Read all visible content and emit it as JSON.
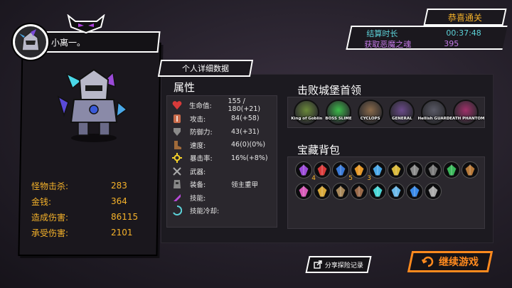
{
  "player": {
    "name": "小离一。"
  },
  "left_stats": [
    {
      "label": "怪物击杀:",
      "value": "283"
    },
    {
      "label": "金钱:",
      "value": "364"
    },
    {
      "label": "造成伤害:",
      "value": "86115"
    },
    {
      "label": "承受伤害:",
      "value": "2101"
    }
  ],
  "tab_label": "个人详细数据",
  "attributes": {
    "title": "属性",
    "rows": [
      {
        "icon": "heart-icon",
        "label": "生命值:",
        "value": "155 / 180(+21)"
      },
      {
        "icon": "sword-icon",
        "label": "攻击:",
        "value": "84(+58)"
      },
      {
        "icon": "shield-icon",
        "label": "防御力:",
        "value": "43(+31)"
      },
      {
        "icon": "boot-icon",
        "label": "速度:",
        "value": "46(0)(0%)"
      },
      {
        "icon": "burst-icon",
        "label": "暴击率:",
        "value": "16%(+8%)"
      },
      {
        "icon": "weapon-icon",
        "label": "武器:",
        "value": ""
      },
      {
        "icon": "armor-icon",
        "label": "装备:",
        "value": "领主重甲"
      },
      {
        "icon": "skill-icon",
        "label": "技能:",
        "value": ""
      },
      {
        "icon": "cooldown-icon",
        "label": "技能冷却:",
        "value": ""
      }
    ]
  },
  "bosses": {
    "title": "击败城堡首领",
    "items": [
      {
        "tag": "King of Goblin",
        "color": "#6b8a3a"
      },
      {
        "tag": "BOSS SLIME",
        "color": "#3dbb4a"
      },
      {
        "tag": "CYCLOPS",
        "color": "#8a6a4a"
      },
      {
        "tag": "GENERAL",
        "color": "#6a4a8a"
      },
      {
        "tag": "Hellish GUARD",
        "color": "#5a5a66"
      },
      {
        "tag": "DEATH PHANTOM",
        "color": "#a0306a"
      }
    ]
  },
  "inventory": {
    "title": "宝藏背包",
    "items": [
      {
        "name": "purple-crystal-icon",
        "color": "#9b4ad8",
        "count": "4"
      },
      {
        "name": "red-gem-icon",
        "color": "#d83a3a",
        "count": ""
      },
      {
        "name": "blue-gem-icon",
        "color": "#3a7ad8",
        "count": "5"
      },
      {
        "name": "fire-orb-icon",
        "color": "#e89a2a",
        "count": "3"
      },
      {
        "name": "blue-shard-icon",
        "color": "#4aa8e8",
        "count": ""
      },
      {
        "name": "gold-ring-icon",
        "color": "#d8b83a",
        "count": ""
      },
      {
        "name": "gray-scroll-icon",
        "color": "#8a8a8a",
        "count": ""
      },
      {
        "name": "hooded-figure-icon",
        "color": "#7a7a7a",
        "count": ""
      },
      {
        "name": "green-flower-icon",
        "color": "#3ab85a",
        "count": ""
      },
      {
        "name": "brown-bag-icon",
        "color": "#b87a3a",
        "count": ""
      },
      {
        "name": "pink-swirl-icon",
        "color": "#d85ab8",
        "count": ""
      },
      {
        "name": "gold-coin-icon",
        "color": "#d8a83a",
        "count": ""
      },
      {
        "name": "treasure-map-icon",
        "color": "#a8885a",
        "count": ""
      },
      {
        "name": "brown-stone-icon",
        "color": "#9a6a4a",
        "count": ""
      },
      {
        "name": "cyan-flake-icon",
        "color": "#4ad8d8",
        "count": ""
      },
      {
        "name": "ice-crystal-icon",
        "color": "#6ab8e8",
        "count": ""
      },
      {
        "name": "blue-flame-icon",
        "color": "#3a8ae8",
        "count": ""
      },
      {
        "name": "knight-helmet-icon",
        "color": "#aaaaaa",
        "count": ""
      }
    ]
  },
  "result": {
    "title": "恭喜通关",
    "rows": [
      {
        "label": "结算时长",
        "value": "00:37:48",
        "tone": "cyan"
      },
      {
        "label": "获取恶魔之魂",
        "value": "395",
        "tone": "purple"
      }
    ]
  },
  "buttons": {
    "share": "分享探险记录",
    "continue": "继续游戏"
  },
  "colors": {
    "gold": "#f5b22a",
    "cyan": "#5cd2d8",
    "purple": "#c57ae8",
    "orange": "#ff8a1e"
  }
}
